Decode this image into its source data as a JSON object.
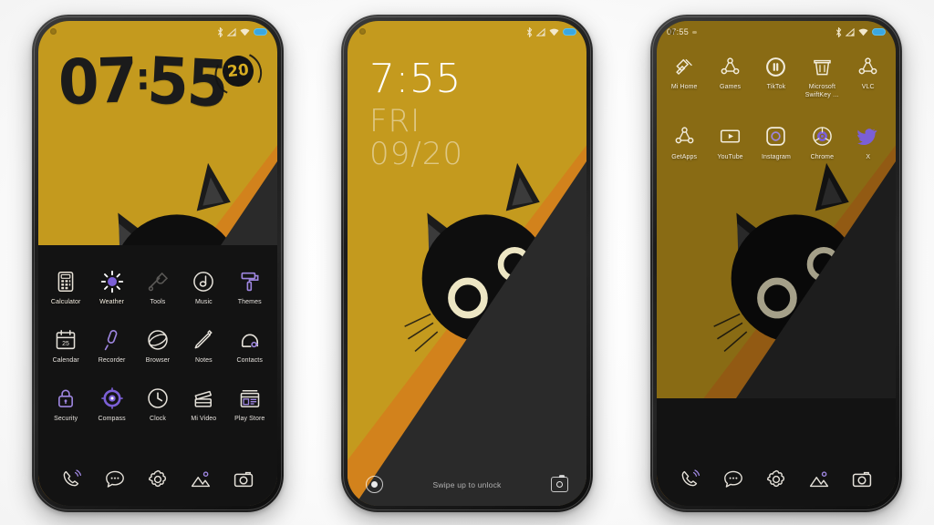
{
  "scene": {
    "background_color": "#ffffff",
    "wallpaper": {
      "name": "peeking-black-cat",
      "yellow": "#C49A1E",
      "orange": "#D2821C",
      "dark": "#282828",
      "cat_body": "#101010",
      "eye_ring": "#EDE6C4"
    }
  },
  "phones": [
    {
      "id": "phone-home-screen",
      "status_bar": {
        "clock": "",
        "icons": [
          "bluetooth-icon",
          "signal-icon",
          "wifi-icon",
          "battery-icon"
        ]
      },
      "clock_widget": {
        "hours": "07",
        "colon": ":",
        "minutes": "55",
        "badge": "20"
      },
      "rows": [
        [
          {
            "label": "Calculator",
            "icon": "calculator-icon"
          },
          {
            "label": "Weather",
            "icon": "weather-sun-icon"
          },
          {
            "label": "Tools",
            "icon": "tools-icon"
          },
          {
            "label": "Music",
            "icon": "music-note-circle-icon"
          },
          {
            "label": "Themes",
            "icon": "paint-roller-icon"
          }
        ],
        [
          {
            "label": "Calendar",
            "icon": "calendar-icon"
          },
          {
            "label": "Recorder",
            "icon": "microphone-icon"
          },
          {
            "label": "Browser",
            "icon": "globe-icon"
          },
          {
            "label": "Notes",
            "icon": "pencil-icon"
          },
          {
            "label": "Contacts",
            "icon": "contacts-icon"
          }
        ],
        [
          {
            "label": "Security",
            "icon": "lock-icon"
          },
          {
            "label": "Compass",
            "icon": "compass-icon"
          },
          {
            "label": "Clock",
            "icon": "clock-icon"
          },
          {
            "label": "Mi Video",
            "icon": "clapperboard-icon"
          },
          {
            "label": "Play Store",
            "icon": "storefront-icon"
          }
        ]
      ],
      "dock": [
        {
          "name": "phone-icon"
        },
        {
          "name": "messages-icon"
        },
        {
          "name": "settings-gear-icon"
        },
        {
          "name": "gallery-icon"
        },
        {
          "name": "camera-icon"
        }
      ]
    },
    {
      "id": "phone-lock-screen",
      "status_bar": {
        "clock": "",
        "icons": [
          "bluetooth-icon",
          "signal-icon",
          "wifi-icon",
          "battery-icon"
        ]
      },
      "time": "7:55",
      "day": "FRI",
      "date": "09/20",
      "hint": "Swipe up to unlock",
      "left_shortcut": "flashlight-icon",
      "right_shortcut": "camera-icon"
    },
    {
      "id": "phone-app-drawer",
      "status_bar": {
        "clock": "07:55",
        "icons": [
          "bluetooth-icon",
          "signal-icon",
          "wifi-icon",
          "battery-icon"
        ]
      },
      "rows": [
        [
          {
            "label": "Mi Home",
            "icon": "flashlight-icon"
          },
          {
            "label": "Games",
            "icon": "games-hub-icon"
          },
          {
            "label": "TikTok",
            "icon": "tiktok-pause-icon"
          },
          {
            "label": "Microsoft SwiftKey …",
            "icon": "keyboard-basket-icon"
          },
          {
            "label": "VLC",
            "icon": "vlc-cone-icon"
          }
        ],
        [
          {
            "label": "GetApps",
            "icon": "getapps-icon"
          },
          {
            "label": "YouTube",
            "icon": "youtube-play-icon"
          },
          {
            "label": "Instagram",
            "icon": "instagram-icon"
          },
          {
            "label": "Chrome",
            "icon": "chrome-icon"
          },
          {
            "label": "X",
            "icon": "x-bird-icon"
          }
        ]
      ],
      "dock": [
        {
          "name": "phone-icon"
        },
        {
          "name": "messages-icon"
        },
        {
          "name": "settings-gear-icon"
        },
        {
          "name": "gallery-icon"
        },
        {
          "name": "camera-icon"
        }
      ]
    }
  ]
}
